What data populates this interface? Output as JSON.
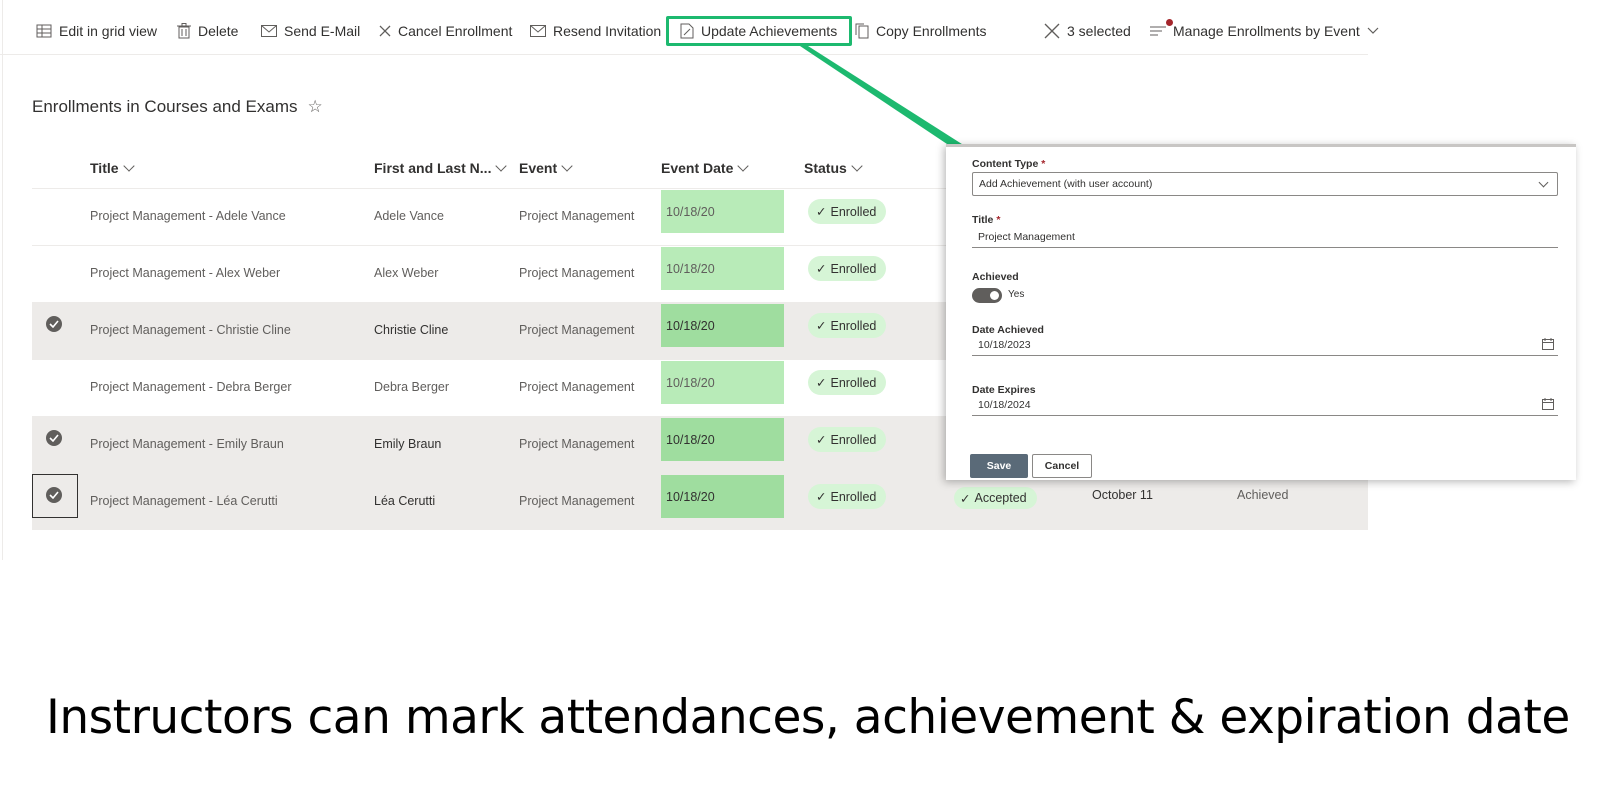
{
  "toolbar": {
    "items": [
      {
        "label": "Edit in grid view",
        "icon": "grid-icon"
      },
      {
        "label": "Delete",
        "icon": "trash-icon"
      },
      {
        "label": "Send E-Mail",
        "icon": "mail-icon"
      },
      {
        "label": "Cancel Enrollment",
        "icon": "x-icon"
      },
      {
        "label": "Resend Invitation",
        "icon": "mail-icon"
      },
      {
        "label": "Update Achievements",
        "icon": "edit-icon",
        "highlighted": true
      },
      {
        "label": "Copy Enrollments",
        "icon": "copy-icon"
      }
    ],
    "selection": {
      "label": "3 selected",
      "icon": "close-icon"
    },
    "view": {
      "label": "Manage Enrollments by Event",
      "icon": "lines-icon",
      "notification": true
    }
  },
  "page": {
    "title": "Enrollments in Courses and Exams"
  },
  "list": {
    "columns": [
      "Title",
      "First and Last N...",
      "Event",
      "Event Date",
      "Status"
    ],
    "rows": [
      {
        "title": "Project Management - Adele Vance",
        "name": "Adele Vance",
        "event": "Project Management",
        "event_date": "10/18/20",
        "status": "Enrolled",
        "selected": false
      },
      {
        "title": "Project Management - Alex Weber",
        "name": "Alex Weber",
        "event": "Project Management",
        "event_date": "10/18/20",
        "status": "Enrolled",
        "selected": false
      },
      {
        "title": "Project Management - Christie Cline",
        "name": "Christie Cline",
        "event": "Project Management",
        "event_date": "10/18/20",
        "status": "Enrolled",
        "selected": true
      },
      {
        "title": "Project Management - Debra Berger",
        "name": "Debra Berger",
        "event": "Project Management",
        "event_date": "10/18/20",
        "status": "Enrolled",
        "selected": false
      },
      {
        "title": "Project Management - Emily Braun",
        "name": "Emily Braun",
        "event": "Project Management",
        "event_date": "10/18/20",
        "status": "Enrolled",
        "selected": true
      },
      {
        "title": "Project Management - Léa Cerutti",
        "name": "Léa Cerutti",
        "event": "Project Management",
        "event_date": "10/18/20",
        "status": "Enrolled",
        "selected": true,
        "focused": true,
        "invitation": "Accepted",
        "date_text": "October 11",
        "achievement": "Achieved"
      }
    ]
  },
  "panel": {
    "content_type_label": "Content Type",
    "content_type_value": "Add Achievement (with user account)",
    "title_label": "Title",
    "title_value": "Project Management",
    "achieved_label": "Achieved",
    "achieved_value": "Yes",
    "date_achieved_label": "Date Achieved",
    "date_achieved_value": "10/18/2023",
    "date_expires_label": "Date Expires",
    "date_expires_value": "10/18/2024",
    "save_label": "Save",
    "cancel_label": "Cancel",
    "required_mark": "*"
  },
  "caption": "Instructors can mark attendances, achievement & expiration date",
  "colors": {
    "highlight": "#1db96f",
    "date_cell": "#b8ebb8",
    "status_pill": "#d6f5d6",
    "selected_row": "#edebe9",
    "save_button": "#5a6a78"
  }
}
